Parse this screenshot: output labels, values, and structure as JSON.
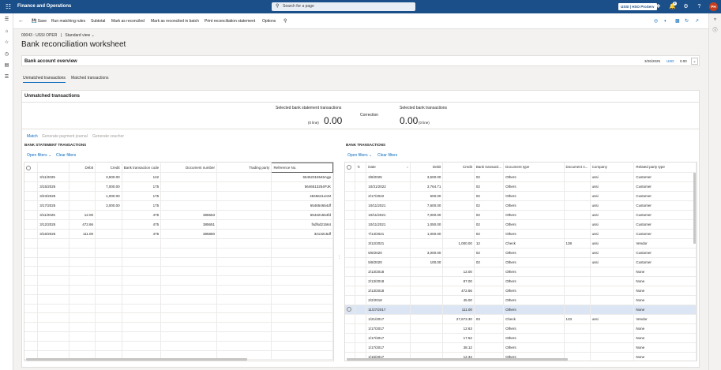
{
  "topbar": {
    "app_name": "Finance and Operations",
    "search_placeholder": "Search for a page",
    "company": "USSI | HSO ProServ",
    "avatar_initials": "PH",
    "notification_count": "2"
  },
  "actionpane": {
    "save": "Save",
    "run_matching_rules": "Run matching rules",
    "subtotal": "Subtotal",
    "mark_as_reconciled": "Mark as reconciled",
    "mark_as_reconciled_batch": "Mark as reconciled in batch",
    "print_statement": "Print reconciliation statement",
    "options": "Options"
  },
  "header": {
    "record": "00043 : USSI OPER",
    "separator": "|",
    "view": "Standard view",
    "title": "Bank reconciliation worksheet"
  },
  "overview": {
    "title": "Bank account overview",
    "date": "3/26/2025",
    "currency": "USD",
    "amount": "0.00"
  },
  "tabs": [
    "Unmatched transactions",
    "Matched transactions"
  ],
  "unmatched": {
    "title": "Unmatched transactions",
    "selected_statement_label": "Selected bank statement transactions",
    "selected_statement_value": "0.00",
    "selected_statement_lines": "(0 line)",
    "correction_label": "Correction",
    "selected_bank_label": "Selected bank transactions",
    "selected_bank_value": "0.00",
    "selected_bank_lines": "(0 line)",
    "actions": {
      "match": "Match",
      "generate_payment_journal": "Generate payment journal",
      "generate_voucher": "Generate voucher"
    }
  },
  "statement_grid": {
    "title": "BANK STATEMENT TRANSACTIONS",
    "open_filters": "Open filters",
    "clear_filters": "Clear filters",
    "columns": [
      "Debit",
      "Credit",
      "Bank transaction code",
      "Document number",
      "Trading party",
      "Reference No."
    ],
    "rows": [
      [
        "3/11/2025",
        "",
        "3,500.00",
        "142",
        "",
        "",
        "65452316546Agp"
      ],
      [
        "3/15/2025",
        "",
        "7,000.00",
        "175",
        "",
        "",
        "5646513254PJK"
      ],
      [
        "3/23/2025",
        "",
        "1,000.00",
        "175",
        "",
        "",
        "4845641LKM"
      ],
      [
        "3/17/2025",
        "",
        "3,000.00",
        "175",
        "",
        "",
        "654654654df"
      ],
      [
        "3/11/2025",
        "12.00",
        "",
        "475",
        "385553",
        "",
        "654321564fd"
      ],
      [
        "3/12/2025",
        "472.66",
        "",
        "475",
        "385651",
        "",
        "fsdfsd21564"
      ],
      [
        "3/16/2025",
        "111.00",
        "",
        "475",
        "385850",
        "",
        "3213215df"
      ]
    ]
  },
  "bank_grid": {
    "title": "BANK TRANSACTIONS",
    "open_filters": "Open filters",
    "clear_filters": "Clear filters",
    "columns": [
      "Date",
      "Debit",
      "Credit",
      "Bank transacti...",
      "Document type",
      "Document n...",
      "Company",
      "Related party type"
    ],
    "rows": [
      [
        "3/8/2025",
        "3,500.00",
        "",
        "02",
        "Others",
        "",
        "ussi",
        "Customer"
      ],
      [
        "10/31/2022",
        "3,764.71",
        "",
        "02",
        "Others",
        "",
        "ussi",
        "Customer"
      ],
      [
        "2/17/2022",
        "500.00",
        "",
        "02",
        "Others",
        "",
        "ussi",
        "Customer"
      ],
      [
        "10/11/2021",
        "7,600.00",
        "",
        "02",
        "Others",
        "",
        "ussi",
        "Customer"
      ],
      [
        "10/11/2021",
        "7,000.00",
        "",
        "02",
        "Others",
        "",
        "ussi",
        "Customer"
      ],
      [
        "10/11/2021",
        "1,050.00",
        "",
        "02",
        "Others",
        "",
        "ussi",
        "Customer"
      ],
      [
        "7/14/2021",
        "1,000.00",
        "",
        "02",
        "Others",
        "",
        "ussi",
        "Customer"
      ],
      [
        "3/12/2021",
        "",
        "1,000.00",
        "12",
        "Check",
        "138",
        "ussi",
        "Vendor"
      ],
      [
        "5/6/2020",
        "3,000.00",
        "",
        "02",
        "Others",
        "",
        "ussi",
        "Customer"
      ],
      [
        "5/8/2020",
        "100.00",
        "",
        "02",
        "Others",
        "",
        "ussi",
        "Customer"
      ],
      [
        "2/13/2018",
        "",
        "12.00",
        "",
        "Others",
        "",
        "",
        "None"
      ],
      [
        "2/13/2018",
        "",
        "87.00",
        "",
        "Others",
        "",
        "",
        "None"
      ],
      [
        "2/13/2018",
        "",
        "472.66",
        "",
        "Others",
        "",
        "",
        "None"
      ],
      [
        "2/2/2018",
        "",
        "45.00",
        "",
        "Others",
        "",
        "",
        "None"
      ],
      [
        "11/27/2017",
        "",
        "111.00",
        "",
        "Others",
        "",
        "",
        "None"
      ],
      [
        "1/21/2017",
        "",
        "27,673.30",
        "03",
        "Check",
        "133",
        "ussi",
        "Vendor"
      ],
      [
        "1/17/2017",
        "",
        "12.63",
        "",
        "Others",
        "",
        "",
        "None"
      ],
      [
        "1/17/2017",
        "",
        "17.52",
        "",
        "Others",
        "",
        "",
        "None"
      ],
      [
        "1/17/2017",
        "",
        "38.12",
        "",
        "Others",
        "",
        "",
        "None"
      ],
      [
        "1/16/2017",
        "",
        "12.34",
        "",
        "Others",
        "",
        "",
        "None"
      ]
    ],
    "selected_row_index": 14
  },
  "colors": {
    "topbar": "#1b4f8a",
    "accent": "#0f6cbd",
    "selected_row": "#dbe5f4"
  }
}
